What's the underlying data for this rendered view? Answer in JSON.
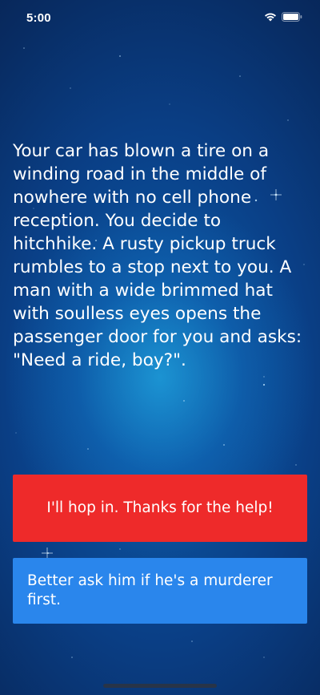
{
  "status_bar": {
    "time": "5:00"
  },
  "story": {
    "text": "Your car has blown a tire on a winding road in the middle of nowhere with no cell phone reception. You decide to hitchhike. A rusty pickup truck rumbles to a stop next to you. A man with a wide brimmed hat with soulless eyes opens the passenger door for you and asks: \"Need a ride, boy?\"."
  },
  "choices": [
    {
      "label": "I'll hop in. Thanks for the help!",
      "color": "#ee2a2a"
    },
    {
      "label": "Better ask him if he's a murderer first.",
      "color": "#2a86ec"
    }
  ],
  "colors": {
    "background": "#0a3f86",
    "text": "#ffffff"
  }
}
